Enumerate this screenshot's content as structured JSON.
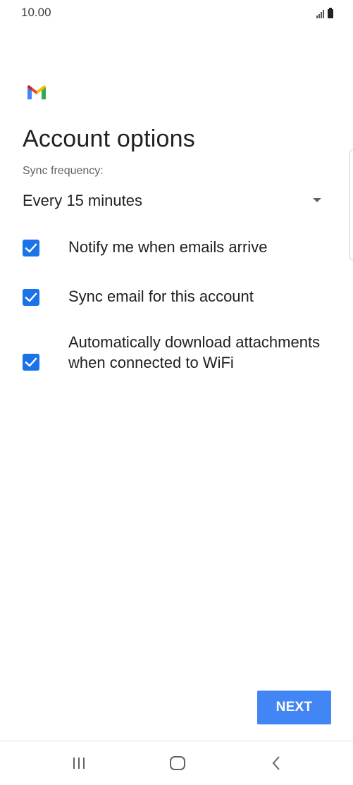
{
  "status_bar": {
    "time": "10.00"
  },
  "app": {
    "logo_icon": "gmail-logo"
  },
  "page": {
    "title": "Account options"
  },
  "sync": {
    "label": "Sync frequency:",
    "selected": "Every 15 minutes"
  },
  "options": [
    {
      "label": "Notify me when emails arrive",
      "checked": true
    },
    {
      "label": "Sync email for this account",
      "checked": true
    },
    {
      "label": "Automatically download attachments when connected to WiFi",
      "checked": true
    }
  ],
  "actions": {
    "next_label": "NEXT"
  },
  "colors": {
    "accent": "#1a73e8",
    "button": "#4285f4"
  },
  "nav_bar": {
    "icons": [
      "recent-apps-icon",
      "home-icon",
      "back-icon"
    ]
  }
}
